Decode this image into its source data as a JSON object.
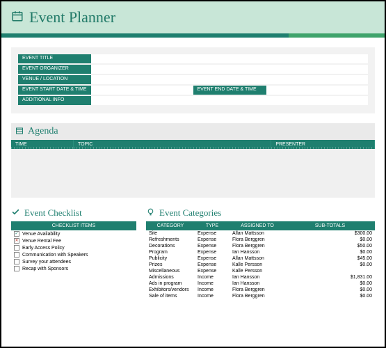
{
  "header": {
    "title": "Event Planner"
  },
  "event_fields": {
    "title_label": "EVENT TITLE",
    "organizer_label": "EVENT ORGANIZER",
    "venue_label": "VENUE / LOCATION",
    "start_label": "EVENT START DATE & TIME",
    "end_label": "EVENT END DATE & TIME",
    "additional_label": "ADDITIONAL INFO"
  },
  "agenda": {
    "heading": "Agenda",
    "cols": {
      "time": "TIME",
      "topic": "TOPIC",
      "presenter": "PRESENTER"
    }
  },
  "checklist": {
    "heading": "Event Checklist",
    "col_header": "CHECKLIST ITEMS",
    "items": [
      {
        "state": "check",
        "label": "Venue Availability"
      },
      {
        "state": "cross",
        "label": "Venue Rental Fee"
      },
      {
        "state": "empty",
        "label": "Early Access Policy"
      },
      {
        "state": "empty",
        "label": "Communication with Speakers"
      },
      {
        "state": "empty",
        "label": "Survey your attendees"
      },
      {
        "state": "empty",
        "label": "Recap with Sponsors"
      }
    ]
  },
  "categories": {
    "heading": "Event Categories",
    "cols": {
      "category": "CATEGORY",
      "type": "TYPE",
      "assigned": "ASSIGNED TO",
      "subtotals": "SUB-TOTALS"
    },
    "rows": [
      {
        "category": "Site",
        "type": "Expense",
        "assigned": "Allan Mattsson",
        "subtotal": "$300.00"
      },
      {
        "category": "Refreshments",
        "type": "Expense",
        "assigned": "Flora Berggren",
        "subtotal": "$0.00"
      },
      {
        "category": "Decorations",
        "type": "Expense",
        "assigned": "Flora Berggren",
        "subtotal": "$50.00"
      },
      {
        "category": "Program",
        "type": "Expense",
        "assigned": "Ian Hansson",
        "subtotal": "$0.00"
      },
      {
        "category": "Publicity",
        "type": "Expense",
        "assigned": "Allan Mattsson",
        "subtotal": "$45.00"
      },
      {
        "category": "Prizes",
        "type": "Expense",
        "assigned": "Kalle Persson",
        "subtotal": "$0.00"
      },
      {
        "category": "Miscellaneous",
        "type": "Expense",
        "assigned": "Kalle Persson",
        "subtotal": ""
      },
      {
        "category": "Admissions",
        "type": "Income",
        "assigned": "Ian Hansson",
        "subtotal": "$1,831.00"
      },
      {
        "category": "Ads in program",
        "type": "Income",
        "assigned": "Ian Hansson",
        "subtotal": "$0.00"
      },
      {
        "category": "Exhibitors/vendors",
        "type": "Income",
        "assigned": "Flora Berggren",
        "subtotal": "$0.00"
      },
      {
        "category": "Sale of items",
        "type": "Income",
        "assigned": "Flora Berggren",
        "subtotal": "$0.00"
      }
    ]
  }
}
